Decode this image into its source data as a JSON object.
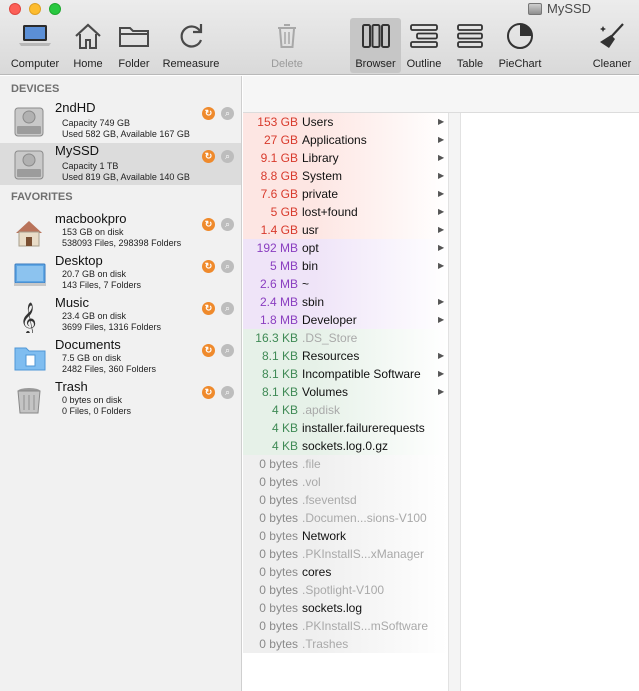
{
  "window": {
    "title": "MySSD"
  },
  "toolbar": {
    "buttons": [
      {
        "label": "Computer",
        "icon": "laptop-icon"
      },
      {
        "label": "Home",
        "icon": "house-icon"
      },
      {
        "label": "Folder",
        "icon": "folder-icon"
      },
      {
        "label": "Remeasure",
        "icon": "refresh-icon"
      },
      {
        "label": "Delete",
        "icon": "trash-icon",
        "disabled": true
      },
      {
        "label": "Browser",
        "icon": "columns-icon",
        "active": true
      },
      {
        "label": "Outline",
        "icon": "outline-icon"
      },
      {
        "label": "Table",
        "icon": "table-icon"
      },
      {
        "label": "PieChart",
        "icon": "piechart-icon"
      },
      {
        "label": "Cleaner",
        "icon": "broom-icon"
      }
    ]
  },
  "sidebar": {
    "devices_heading": "DEVICES",
    "favorites_heading": "FAVORITES",
    "devices": [
      {
        "name": "2ndHD",
        "line1": "Capacity 749 GB",
        "line2": "Used 582 GB, Available 167 GB",
        "icon": "harddisk-icon"
      },
      {
        "name": "MySSD",
        "line1": "Capacity 1 TB",
        "line2": "Used 819 GB, Available 140 GB",
        "icon": "harddisk-icon"
      }
    ],
    "favorites": [
      {
        "name": "macbookpro",
        "line1": "153 GB on disk",
        "line2": "538093 Files, 298398 Folders",
        "icon": "house-icon"
      },
      {
        "name": "Desktop",
        "line1": "20.7 GB on disk",
        "line2": "143 Files, 7 Folders",
        "icon": "desktop-icon"
      },
      {
        "name": "Music",
        "line1": "23.4 GB on disk",
        "line2": "3699 Files, 1316 Folders",
        "icon": "music-icon"
      },
      {
        "name": "Documents",
        "line1": "7.5 GB on disk",
        "line2": "2482 Files, 360 Folders",
        "icon": "documents-icon"
      },
      {
        "name": "Trash",
        "line1": "0 bytes on disk",
        "line2": "0 Files, 0 Folders",
        "icon": "trash-icon"
      }
    ]
  },
  "colors": {
    "gb": "#d83a2c",
    "mb": "#8a3ec0",
    "kb": "#3f8a55",
    "bytes": "#8a8a8a",
    "gb_bg": "#fde6e3",
    "mb_bg": "#efe4f8",
    "kb_bg": "#e6f1e8",
    "bytes_bg": "#efefef"
  },
  "browser": {
    "rows": [
      {
        "size": "153 GB",
        "name": "Users",
        "unit": "gb",
        "arrow": true
      },
      {
        "size": "27 GB",
        "name": "Applications",
        "unit": "gb",
        "arrow": true
      },
      {
        "size": "9.1 GB",
        "name": "Library",
        "unit": "gb",
        "arrow": true
      },
      {
        "size": "8.8 GB",
        "name": "System",
        "unit": "gb",
        "arrow": true
      },
      {
        "size": "7.6 GB",
        "name": "private",
        "unit": "gb",
        "arrow": true
      },
      {
        "size": "5 GB",
        "name": "lost+found",
        "unit": "gb",
        "arrow": true
      },
      {
        "size": "1.4 GB",
        "name": "usr",
        "unit": "gb",
        "arrow": true
      },
      {
        "size": "192 MB",
        "name": "opt",
        "unit": "mb",
        "arrow": true
      },
      {
        "size": "5 MB",
        "name": "bin",
        "unit": "mb",
        "arrow": true
      },
      {
        "size": "2.6 MB",
        "name": "~",
        "unit": "mb",
        "arrow": false
      },
      {
        "size": "2.4 MB",
        "name": "sbin",
        "unit": "mb",
        "arrow": true
      },
      {
        "size": "1.8 MB",
        "name": "Developer",
        "unit": "mb",
        "arrow": true
      },
      {
        "size": "16.3 KB",
        "name": ".DS_Store",
        "unit": "kb",
        "arrow": false,
        "hidden": true
      },
      {
        "size": "8.1 KB",
        "name": "Resources",
        "unit": "kb",
        "arrow": true
      },
      {
        "size": "8.1 KB",
        "name": "Incompatible Software",
        "unit": "kb",
        "arrow": true
      },
      {
        "size": "8.1 KB",
        "name": "Volumes",
        "unit": "kb",
        "arrow": true
      },
      {
        "size": "4 KB",
        "name": ".apdisk",
        "unit": "kb",
        "arrow": false,
        "hidden": true
      },
      {
        "size": "4 KB",
        "name": "installer.failurerequests",
        "unit": "kb",
        "arrow": false
      },
      {
        "size": "4 KB",
        "name": "sockets.log.0.gz",
        "unit": "kb",
        "arrow": false
      },
      {
        "size": "0 bytes",
        "name": ".file",
        "unit": "bytes",
        "arrow": false,
        "hidden": true
      },
      {
        "size": "0 bytes",
        "name": ".vol",
        "unit": "bytes",
        "arrow": false,
        "hidden": true
      },
      {
        "size": "0 bytes",
        "name": ".fseventsd",
        "unit": "bytes",
        "arrow": false,
        "hidden": true
      },
      {
        "size": "0 bytes",
        "name": ".Documen...sions-V100",
        "unit": "bytes",
        "arrow": false,
        "hidden": true
      },
      {
        "size": "0 bytes",
        "name": "Network",
        "unit": "bytes",
        "arrow": false
      },
      {
        "size": "0 bytes",
        "name": ".PKInstallS...xManager",
        "unit": "bytes",
        "arrow": false,
        "hidden": true
      },
      {
        "size": "0 bytes",
        "name": "cores",
        "unit": "bytes",
        "arrow": false
      },
      {
        "size": "0 bytes",
        "name": ".Spotlight-V100",
        "unit": "bytes",
        "arrow": false,
        "hidden": true
      },
      {
        "size": "0 bytes",
        "name": "sockets.log",
        "unit": "bytes",
        "arrow": false
      },
      {
        "size": "0 bytes",
        "name": ".PKInstallS...mSoftware",
        "unit": "bytes",
        "arrow": false,
        "hidden": true
      },
      {
        "size": "0 bytes",
        "name": ".Trashes",
        "unit": "bytes",
        "arrow": false,
        "hidden": true
      }
    ]
  }
}
